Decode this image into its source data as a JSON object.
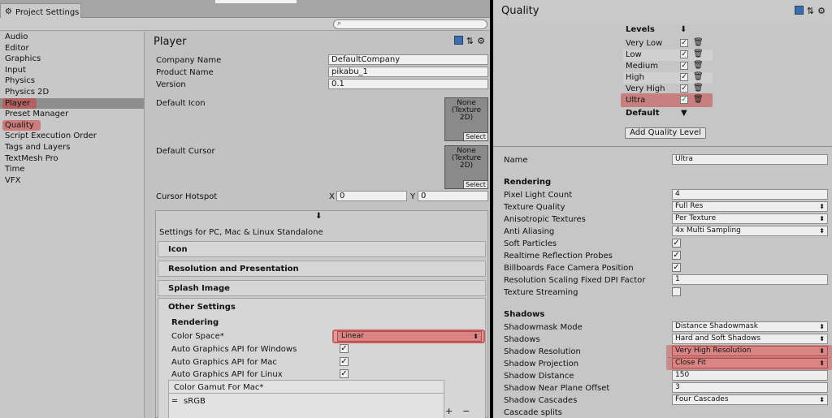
{
  "left": {
    "tab_title": "Project Settings",
    "sidebar": {
      "items": [
        {
          "label": "Audio"
        },
        {
          "label": "Editor"
        },
        {
          "label": "Graphics"
        },
        {
          "label": "Input"
        },
        {
          "label": "Physics"
        },
        {
          "label": "Physics 2D"
        },
        {
          "label": "Player"
        },
        {
          "label": "Preset Manager"
        },
        {
          "label": "Quality"
        },
        {
          "label": "Script Execution Order"
        },
        {
          "label": "Tags and Layers"
        },
        {
          "label": "TextMesh Pro"
        },
        {
          "label": "Time"
        },
        {
          "label": "VFX"
        }
      ]
    },
    "player": {
      "title": "Player",
      "company_label": "Company Name",
      "company_value": "DefaultCompany",
      "product_label": "Product Name",
      "product_value": "pikabu_1",
      "version_label": "Version",
      "version_value": "0.1",
      "icon_label": "Default Icon",
      "cursor_label": "Default Cursor",
      "tex_none": "None",
      "tex_type": "(Texture",
      "tex_2d": "2D)",
      "select_label": "Select",
      "hotspot_label": "Cursor Hotspot",
      "x_label": "X",
      "x_value": "0",
      "y_label": "Y",
      "y_value": "0"
    },
    "platform": {
      "title": "Settings for PC, Mac & Linux Standalone",
      "sections": {
        "icon": "Icon",
        "resolution": "Resolution and Presentation",
        "splash": "Splash Image",
        "other": "Other Settings"
      },
      "rendering_label": "Rendering",
      "color_space_label": "Color Space*",
      "color_space_value": "Linear",
      "auto_win_label": "Auto Graphics API  for Windows",
      "auto_mac_label": "Auto Graphics API  for Mac",
      "auto_linux_label": "Auto Graphics API  for Linux",
      "gamut_label": "Color Gamut For Mac*",
      "gamut_value": "sRGB",
      "plus": "+",
      "minus": "−"
    }
  },
  "right": {
    "title": "Quality",
    "levels_label": "Levels",
    "levels": [
      {
        "name": "Very Low"
      },
      {
        "name": "Low"
      },
      {
        "name": "Medium"
      },
      {
        "name": "High"
      },
      {
        "name": "Very High"
      },
      {
        "name": "Ultra"
      }
    ],
    "default_label": "Default",
    "add_button": "Add Quality Level",
    "name_label": "Name",
    "name_value": "Ultra",
    "rendering_header": "Rendering",
    "pixel_light_label": "Pixel Light Count",
    "pixel_light_value": "4",
    "texture_quality_label": "Texture Quality",
    "texture_quality_value": "Full Res",
    "aniso_label": "Anisotropic Textures",
    "aniso_value": "Per Texture",
    "aa_label": "Anti Aliasing",
    "aa_value": "4x Multi Sampling",
    "soft_particles_label": "Soft Particles",
    "realtime_probes_label": "Realtime Reflection Probes",
    "billboards_label": "Billboards Face Camera Position",
    "dpi_label": "Resolution Scaling Fixed DPI Factor",
    "dpi_value": "1",
    "streaming_label": "Texture Streaming",
    "shadows_header": "Shadows",
    "shadowmask_label": "Shadowmask Mode",
    "shadowmask_value": "Distance Shadowmask",
    "shadows_label": "Shadows",
    "shadows_value": "Hard and Soft Shadows",
    "shadow_res_label": "Shadow Resolution",
    "shadow_res_value": "Very High Resolution",
    "shadow_proj_label": "Shadow Projection",
    "shadow_proj_value": "Close Fit",
    "shadow_dist_label": "Shadow Distance",
    "shadow_dist_value": "150",
    "near_plane_label": "Shadow Near Plane Offset",
    "near_plane_value": "3",
    "cascades_label": "Shadow Cascades",
    "cascades_value": "Four Cascades",
    "cascade_splits_label": "Cascade splits"
  }
}
